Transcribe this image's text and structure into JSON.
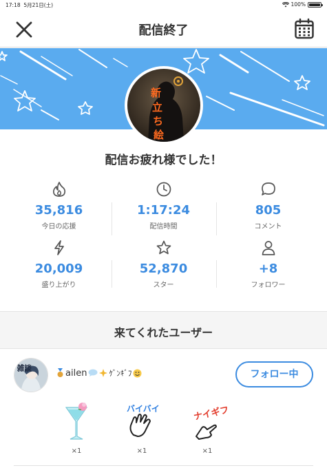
{
  "status_bar": {
    "time": "17:18",
    "date": "5月21日(土)",
    "battery": "100%"
  },
  "nav": {
    "title": "配信終了"
  },
  "thanks_message": "配信お疲れ様でした！",
  "avatar": {
    "text_chars": [
      "新",
      "立",
      "ち",
      "絵"
    ]
  },
  "stats": [
    {
      "icon": "flame-icon",
      "value": "35,816",
      "label": "今日の応援"
    },
    {
      "icon": "clock-icon",
      "value": "1:17:24",
      "label": "配信時間"
    },
    {
      "icon": "comment-icon",
      "value": "805",
      "label": "コメント"
    },
    {
      "icon": "lightning-icon",
      "value": "20,009",
      "label": "盛り上がり"
    },
    {
      "icon": "star-icon",
      "value": "52,870",
      "label": "スター"
    },
    {
      "icon": "person-icon",
      "value": "+8",
      "label": "フォロワー"
    }
  ],
  "section": {
    "title": "来てくれたユーザー"
  },
  "user": {
    "name": "ailen",
    "name_suffix": "ｹﾞﾝｷﾞﾌ",
    "avatar_text": "雑談",
    "follow_label": "フォロー中"
  },
  "gifts": [
    {
      "icon": "cocktail-icon",
      "count": "×1"
    },
    {
      "icon": "bye-hand-icon",
      "text": "バイバイ",
      "count": "×1"
    },
    {
      "icon": "nice-gift-icon",
      "text": "ナイギフ",
      "count": "×1"
    }
  ],
  "colors": {
    "accent": "#3b8be0",
    "banner": "#5aabef"
  }
}
